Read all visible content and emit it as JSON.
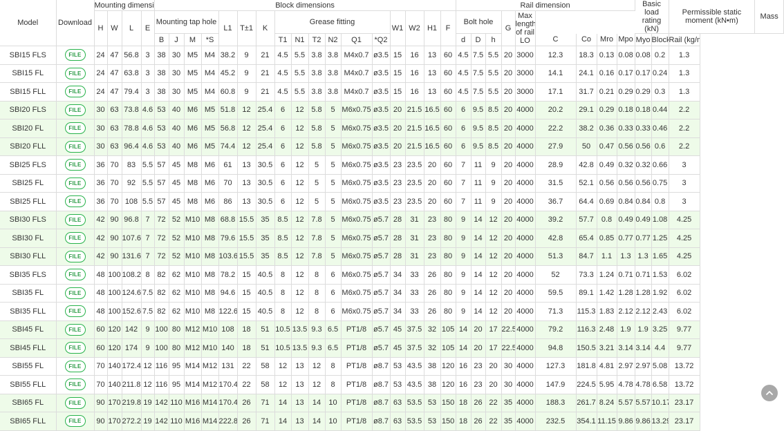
{
  "headers": {
    "model": "Model",
    "download": "Download",
    "mounting_dimension": "Mounting dimension",
    "block_dimensions": "Block dimensions",
    "rail_dimension": "Rail dimension",
    "basic_load_rating": "Basic load rating (kN)",
    "permissible_static_moment": "Permissible static moment (kN•m)",
    "mass": "Mass",
    "mounting_tap_hole": "Mounting tap hole",
    "grease_fitting": "Grease fitting",
    "bolt_hole": "Bolt hole",
    "max_length_rail": "Max length of rail LO",
    "H": "H",
    "W": "W",
    "L": "L",
    "E": "E",
    "B": "B",
    "J": "J",
    "M": "M",
    "S": "*S",
    "L1": "L1",
    "T": "T±1",
    "K": "K",
    "T1": "T1",
    "N1": "N1",
    "T2": "T2",
    "N2": "N2",
    "Q1": "Q1",
    "Q2": "*Q2",
    "W1": "W1",
    "W2": "W2",
    "H1": "H1",
    "F": "F",
    "d": "d",
    "D": "D",
    "h": "h",
    "G": "G",
    "C": "C",
    "Co": "Co",
    "Mro": "Mro",
    "Mpo": "Mpo",
    "Myo": "Myo",
    "block_kg": "Block (kg)",
    "rail_kgm": "Rail (kg/m)"
  },
  "download_label": "FILE",
  "rows": [
    {
      "model": "SBI15 FLS",
      "H": "24",
      "W": "47",
      "L": "56.8",
      "E": "3",
      "B": "38",
      "J": "30",
      "M": "M5",
      "S": "M4",
      "L1": "38.2",
      "T": "9",
      "K": "21",
      "T1": "4.5",
      "N1": "5.5",
      "T2": "3.8",
      "N2": "3.8",
      "Q1": "M4x0.7",
      "Q2": "ø3.5",
      "W1": "15",
      "W2": "16",
      "H1": "13",
      "F": "60",
      "d": "4.5",
      "D": "7.5",
      "h": "5.5",
      "G": "20",
      "LO": "3000",
      "C": "12.3",
      "Co": "18.3",
      "Mro": "0.13",
      "Mpo": "0.08",
      "Myo": "0.08",
      "block": "0.2",
      "rail": "1.3"
    },
    {
      "model": "SBI15 FL",
      "H": "24",
      "W": "47",
      "L": "63.8",
      "E": "3",
      "B": "38",
      "J": "30",
      "M": "M5",
      "S": "M4",
      "L1": "45.2",
      "T": "9",
      "K": "21",
      "T1": "4.5",
      "N1": "5.5",
      "T2": "3.8",
      "N2": "3.8",
      "Q1": "M4x0.7",
      "Q2": "ø3.5",
      "W1": "15",
      "W2": "16",
      "H1": "13",
      "F": "60",
      "d": "4.5",
      "D": "7.5",
      "h": "5.5",
      "G": "20",
      "LO": "3000",
      "C": "14.1",
      "Co": "24.1",
      "Mro": "0.16",
      "Mpo": "0.17",
      "Myo": "0.17",
      "block": "0.24",
      "rail": "1.3"
    },
    {
      "model": "SBI15 FLL",
      "H": "24",
      "W": "47",
      "L": "79.4",
      "E": "3",
      "B": "38",
      "J": "30",
      "M": "M5",
      "S": "M4",
      "L1": "60.8",
      "T": "9",
      "K": "21",
      "T1": "4.5",
      "N1": "5.5",
      "T2": "3.8",
      "N2": "3.8",
      "Q1": "M4x0.7",
      "Q2": "ø3.5",
      "W1": "15",
      "W2": "16",
      "H1": "13",
      "F": "60",
      "d": "4.5",
      "D": "7.5",
      "h": "5.5",
      "G": "20",
      "LO": "3000",
      "C": "17.1",
      "Co": "31.7",
      "Mro": "0.21",
      "Mpo": "0.29",
      "Myo": "0.29",
      "block": "0.3",
      "rail": "1.3"
    },
    {
      "model": "SBI20 FLS",
      "H": "30",
      "W": "63",
      "L": "73.8",
      "E": "4.6",
      "B": "53",
      "J": "40",
      "M": "M6",
      "S": "M5",
      "L1": "51.8",
      "T": "12",
      "K": "25.4",
      "T1": "6",
      "N1": "12",
      "T2": "5.8",
      "N2": "5",
      "Q1": "M6x0.75",
      "Q2": "ø3.5",
      "W1": "20",
      "W2": "21.5",
      "H1": "16.5",
      "F": "60",
      "d": "6",
      "D": "9.5",
      "h": "8.5",
      "G": "20",
      "LO": "4000",
      "C": "20.2",
      "Co": "29.1",
      "Mro": "0.29",
      "Mpo": "0.18",
      "Myo": "0.18",
      "block": "0.44",
      "rail": "2.2"
    },
    {
      "model": "SBI20 FL",
      "H": "30",
      "W": "63",
      "L": "78.8",
      "E": "4.6",
      "B": "53",
      "J": "40",
      "M": "M6",
      "S": "M5",
      "L1": "56.8",
      "T": "12",
      "K": "25.4",
      "T1": "6",
      "N1": "12",
      "T2": "5.8",
      "N2": "5",
      "Q1": "M6x0.75",
      "Q2": "ø3.5",
      "W1": "20",
      "W2": "21.5",
      "H1": "16.5",
      "F": "60",
      "d": "6",
      "D": "9.5",
      "h": "8.5",
      "G": "20",
      "LO": "4000",
      "C": "22.2",
      "Co": "38.2",
      "Mro": "0.36",
      "Mpo": "0.33",
      "Myo": "0.33",
      "block": "0.46",
      "rail": "2.2"
    },
    {
      "model": "SBI20 FLL",
      "H": "30",
      "W": "63",
      "L": "96.4",
      "E": "4.6",
      "B": "53",
      "J": "40",
      "M": "M6",
      "S": "M5",
      "L1": "74.4",
      "T": "12",
      "K": "25.4",
      "T1": "6",
      "N1": "12",
      "T2": "5.8",
      "N2": "5",
      "Q1": "M6x0.75",
      "Q2": "ø3.5",
      "W1": "20",
      "W2": "21.5",
      "H1": "16.5",
      "F": "60",
      "d": "6",
      "D": "9.5",
      "h": "8.5",
      "G": "20",
      "LO": "4000",
      "C": "27.9",
      "Co": "50",
      "Mro": "0.47",
      "Mpo": "0.56",
      "Myo": "0.56",
      "block": "0.6",
      "rail": "2.2"
    },
    {
      "model": "SBI25 FLS",
      "H": "36",
      "W": "70",
      "L": "83",
      "E": "5.5",
      "B": "57",
      "J": "45",
      "M": "M8",
      "S": "M6",
      "L1": "61",
      "T": "13",
      "K": "30.5",
      "T1": "6",
      "N1": "12",
      "T2": "5",
      "N2": "5",
      "Q1": "M6x0.75",
      "Q2": "ø3.5",
      "W1": "23",
      "W2": "23.5",
      "H1": "20",
      "F": "60",
      "d": "7",
      "D": "11",
      "h": "9",
      "G": "20",
      "LO": "4000",
      "C": "28.9",
      "Co": "42.8",
      "Mro": "0.49",
      "Mpo": "0.32",
      "Myo": "0.32",
      "block": "0.66",
      "rail": "3"
    },
    {
      "model": "SBI25 FL",
      "H": "36",
      "W": "70",
      "L": "92",
      "E": "5.5",
      "B": "57",
      "J": "45",
      "M": "M8",
      "S": "M6",
      "L1": "70",
      "T": "13",
      "K": "30.5",
      "T1": "6",
      "N1": "12",
      "T2": "5",
      "N2": "5",
      "Q1": "M6x0.75",
      "Q2": "ø3.5",
      "W1": "23",
      "W2": "23.5",
      "H1": "20",
      "F": "60",
      "d": "7",
      "D": "11",
      "h": "9",
      "G": "20",
      "LO": "4000",
      "C": "31.5",
      "Co": "52.1",
      "Mro": "0.56",
      "Mpo": "0.56",
      "Myo": "0.56",
      "block": "0.75",
      "rail": "3"
    },
    {
      "model": "SBI25 FLL",
      "H": "36",
      "W": "70",
      "L": "108",
      "E": "5.5",
      "B": "57",
      "J": "45",
      "M": "M8",
      "S": "M6",
      "L1": "86",
      "T": "13",
      "K": "30.5",
      "T1": "6",
      "N1": "12",
      "T2": "5",
      "N2": "5",
      "Q1": "M6x0.75",
      "Q2": "ø3.5",
      "W1": "23",
      "W2": "23.5",
      "H1": "20",
      "F": "60",
      "d": "7",
      "D": "11",
      "h": "9",
      "G": "20",
      "LO": "4000",
      "C": "36.7",
      "Co": "64.4",
      "Mro": "0.69",
      "Mpo": "0.84",
      "Myo": "0.84",
      "block": "0.8",
      "rail": "3"
    },
    {
      "model": "SBI30 FLS",
      "H": "42",
      "W": "90",
      "L": "96.8",
      "E": "7",
      "B": "72",
      "J": "52",
      "M": "M10",
      "S": "M8",
      "L1": "68.8",
      "T": "15.5",
      "K": "35",
      "T1": "8.5",
      "N1": "12",
      "T2": "7.8",
      "N2": "5",
      "Q1": "M6x0.75",
      "Q2": "ø5.7",
      "W1": "28",
      "W2": "31",
      "H1": "23",
      "F": "80",
      "d": "9",
      "D": "14",
      "h": "12",
      "G": "20",
      "LO": "4000",
      "C": "39.2",
      "Co": "57.7",
      "Mro": "0.8",
      "Mpo": "0.49",
      "Myo": "0.49",
      "block": "1.08",
      "rail": "4.25"
    },
    {
      "model": "SBI30 FL",
      "H": "42",
      "W": "90",
      "L": "107.6",
      "E": "7",
      "B": "72",
      "J": "52",
      "M": "M10",
      "S": "M8",
      "L1": "79.6",
      "T": "15.5",
      "K": "35",
      "T1": "8.5",
      "N1": "12",
      "T2": "7.8",
      "N2": "5",
      "Q1": "M6x0.75",
      "Q2": "ø5.7",
      "W1": "28",
      "W2": "31",
      "H1": "23",
      "F": "80",
      "d": "9",
      "D": "14",
      "h": "12",
      "G": "20",
      "LO": "4000",
      "C": "42.8",
      "Co": "65.4",
      "Mro": "0.85",
      "Mpo": "0.77",
      "Myo": "0.77",
      "block": "1.25",
      "rail": "4.25"
    },
    {
      "model": "SBI30 FLL",
      "H": "42",
      "W": "90",
      "L": "131.6",
      "E": "7",
      "B": "72",
      "J": "52",
      "M": "M10",
      "S": "M8",
      "L1": "103.6",
      "T": "15.5",
      "K": "35",
      "T1": "8.5",
      "N1": "12",
      "T2": "7.8",
      "N2": "5",
      "Q1": "M6x0.75",
      "Q2": "ø5.7",
      "W1": "28",
      "W2": "31",
      "H1": "23",
      "F": "80",
      "d": "9",
      "D": "14",
      "h": "12",
      "G": "20",
      "LO": "4000",
      "C": "51.3",
      "Co": "84.7",
      "Mro": "1.1",
      "Mpo": "1.3",
      "Myo": "1.3",
      "block": "1.65",
      "rail": "4.25"
    },
    {
      "model": "SBI35 FLS",
      "H": "48",
      "W": "100",
      "L": "108.2",
      "E": "8",
      "B": "82",
      "J": "62",
      "M": "M10",
      "S": "M8",
      "L1": "78.2",
      "T": "15",
      "K": "40.5",
      "T1": "8",
      "N1": "12",
      "T2": "8",
      "N2": "6",
      "Q1": "M6x0.75",
      "Q2": "ø5.7",
      "W1": "34",
      "W2": "33",
      "H1": "26",
      "F": "80",
      "d": "9",
      "D": "14",
      "h": "12",
      "G": "20",
      "LO": "4000",
      "C": "52",
      "Co": "73.3",
      "Mro": "1.24",
      "Mpo": "0.71",
      "Myo": "0.71",
      "block": "1.53",
      "rail": "6.02"
    },
    {
      "model": "SBI35 FL",
      "H": "48",
      "W": "100",
      "L": "124.6",
      "E": "7.5",
      "B": "82",
      "J": "62",
      "M": "M10",
      "S": "M8",
      "L1": "94.6",
      "T": "15",
      "K": "40.5",
      "T1": "8",
      "N1": "12",
      "T2": "8",
      "N2": "6",
      "Q1": "M6x0.75",
      "Q2": "ø5.7",
      "W1": "34",
      "W2": "33",
      "H1": "26",
      "F": "80",
      "d": "9",
      "D": "14",
      "h": "12",
      "G": "20",
      "LO": "4000",
      "C": "59.5",
      "Co": "89.1",
      "Mro": "1.42",
      "Mpo": "1.28",
      "Myo": "1.28",
      "block": "1.92",
      "rail": "6.02"
    },
    {
      "model": "SBI35 FLL",
      "H": "48",
      "W": "100",
      "L": "152.6",
      "E": "7.5",
      "B": "82",
      "J": "62",
      "M": "M10",
      "S": "M8",
      "L1": "122.6",
      "T": "15",
      "K": "40.5",
      "T1": "8",
      "N1": "12",
      "T2": "8",
      "N2": "6",
      "Q1": "M6x0.75",
      "Q2": "ø5.7",
      "W1": "34",
      "W2": "33",
      "H1": "26",
      "F": "80",
      "d": "9",
      "D": "14",
      "h": "12",
      "G": "20",
      "LO": "4000",
      "C": "71.3",
      "Co": "115.3",
      "Mro": "1.83",
      "Mpo": "2.12",
      "Myo": "2.12",
      "block": "2.43",
      "rail": "6.02"
    },
    {
      "model": "SBI45 FL",
      "H": "60",
      "W": "120",
      "L": "142",
      "E": "9",
      "B": "100",
      "J": "80",
      "M": "M12",
      "S": "M10",
      "L1": "108",
      "T": "18",
      "K": "51",
      "T1": "10.5",
      "N1": "13.5",
      "T2": "9.3",
      "N2": "6.5",
      "Q1": "PT1/8",
      "Q2": "ø5.7",
      "W1": "45",
      "W2": "37.5",
      "H1": "32",
      "F": "105",
      "d": "14",
      "D": "20",
      "h": "17",
      "G": "22.5",
      "LO": "4000",
      "C": "79.2",
      "Co": "116.3",
      "Mro": "2.48",
      "Mpo": "1.9",
      "Myo": "1.9",
      "block": "3.25",
      "rail": "9.77"
    },
    {
      "model": "SBI45 FLL",
      "H": "60",
      "W": "120",
      "L": "174",
      "E": "9",
      "B": "100",
      "J": "80",
      "M": "M12",
      "S": "M10",
      "L1": "140",
      "T": "18",
      "K": "51",
      "T1": "10.5",
      "N1": "13.5",
      "T2": "9.3",
      "N2": "6.5",
      "Q1": "PT1/8",
      "Q2": "ø5.7",
      "W1": "45",
      "W2": "37.5",
      "H1": "32",
      "F": "105",
      "d": "14",
      "D": "20",
      "h": "17",
      "G": "22.5",
      "LO": "4000",
      "C": "94.8",
      "Co": "150.5",
      "Mro": "3.21",
      "Mpo": "3.14",
      "Myo": "3.14",
      "block": "4.4",
      "rail": "9.77"
    },
    {
      "model": "SBI55 FL",
      "H": "70",
      "W": "140",
      "L": "172.4",
      "E": "12",
      "B": "116",
      "J": "95",
      "M": "M14",
      "S": "M12",
      "L1": "131",
      "T": "22",
      "K": "58",
      "T1": "12",
      "N1": "13",
      "T2": "12",
      "N2": "8",
      "Q1": "PT1/8",
      "Q2": "ø8.7",
      "W1": "53",
      "W2": "43.5",
      "H1": "38",
      "F": "120",
      "d": "16",
      "D": "23",
      "h": "20",
      "G": "30",
      "LO": "4000",
      "C": "127.3",
      "Co": "181.8",
      "Mro": "4.81",
      "Mpo": "2.97",
      "Myo": "2.97",
      "block": "5.08",
      "rail": "13.72"
    },
    {
      "model": "SBI55 FLL",
      "H": "70",
      "W": "140",
      "L": "211.8",
      "E": "12",
      "B": "116",
      "J": "95",
      "M": "M14",
      "S": "M12",
      "L1": "170.4",
      "T": "22",
      "K": "58",
      "T1": "12",
      "N1": "13",
      "T2": "12",
      "N2": "8",
      "Q1": "PT1/8",
      "Q2": "ø8.7",
      "W1": "53",
      "W2": "43.5",
      "H1": "38",
      "F": "120",
      "d": "16",
      "D": "23",
      "h": "20",
      "G": "30",
      "LO": "4000",
      "C": "147.9",
      "Co": "224.5",
      "Mro": "5.95",
      "Mpo": "4.78",
      "Myo": "4.78",
      "block": "6.58",
      "rail": "13.72"
    },
    {
      "model": "SBI65 FL",
      "H": "90",
      "W": "170",
      "L": "219.8",
      "E": "19",
      "B": "142",
      "J": "110",
      "M": "M16",
      "S": "M14",
      "L1": "170.4",
      "T": "26",
      "K": "71",
      "T1": "14",
      "N1": "13",
      "T2": "14",
      "N2": "10",
      "Q1": "PT1/8",
      "Q2": "ø8.7",
      "W1": "63",
      "W2": "53.5",
      "H1": "53",
      "F": "150",
      "d": "18",
      "D": "26",
      "h": "22",
      "G": "35",
      "LO": "4000",
      "C": "188.3",
      "Co": "261.7",
      "Mro": "8.24",
      "Mpo": "5.57",
      "Myo": "5.57",
      "block": "10.17",
      "rail": "23.17"
    },
    {
      "model": "SBI65 FLL",
      "H": "90",
      "W": "170",
      "L": "272.2",
      "E": "19",
      "B": "142",
      "J": "110",
      "M": "M16",
      "S": "M14",
      "L1": "222.8",
      "T": "26",
      "K": "71",
      "T1": "14",
      "N1": "13",
      "T2": "14",
      "N2": "10",
      "Q1": "PT1/8",
      "Q2": "ø8.7",
      "W1": "63",
      "W2": "53.5",
      "H1": "53",
      "F": "150",
      "d": "18",
      "D": "26",
      "h": "22",
      "G": "35",
      "LO": "4000",
      "C": "232.5",
      "Co": "354.1",
      "Mro": "11.15",
      "Mpo": "9.86",
      "Myo": "9.86",
      "block": "13.29",
      "rail": "23.17"
    }
  ],
  "colors": {
    "row_highlight": "#eefbe9",
    "button_border": "#27b24a",
    "button_text": "#2b9b46",
    "grid": "#dcdcdc",
    "scroll_button": "#9a9a9a"
  },
  "icons": {
    "scroll_top": "chevron-up-icon"
  }
}
